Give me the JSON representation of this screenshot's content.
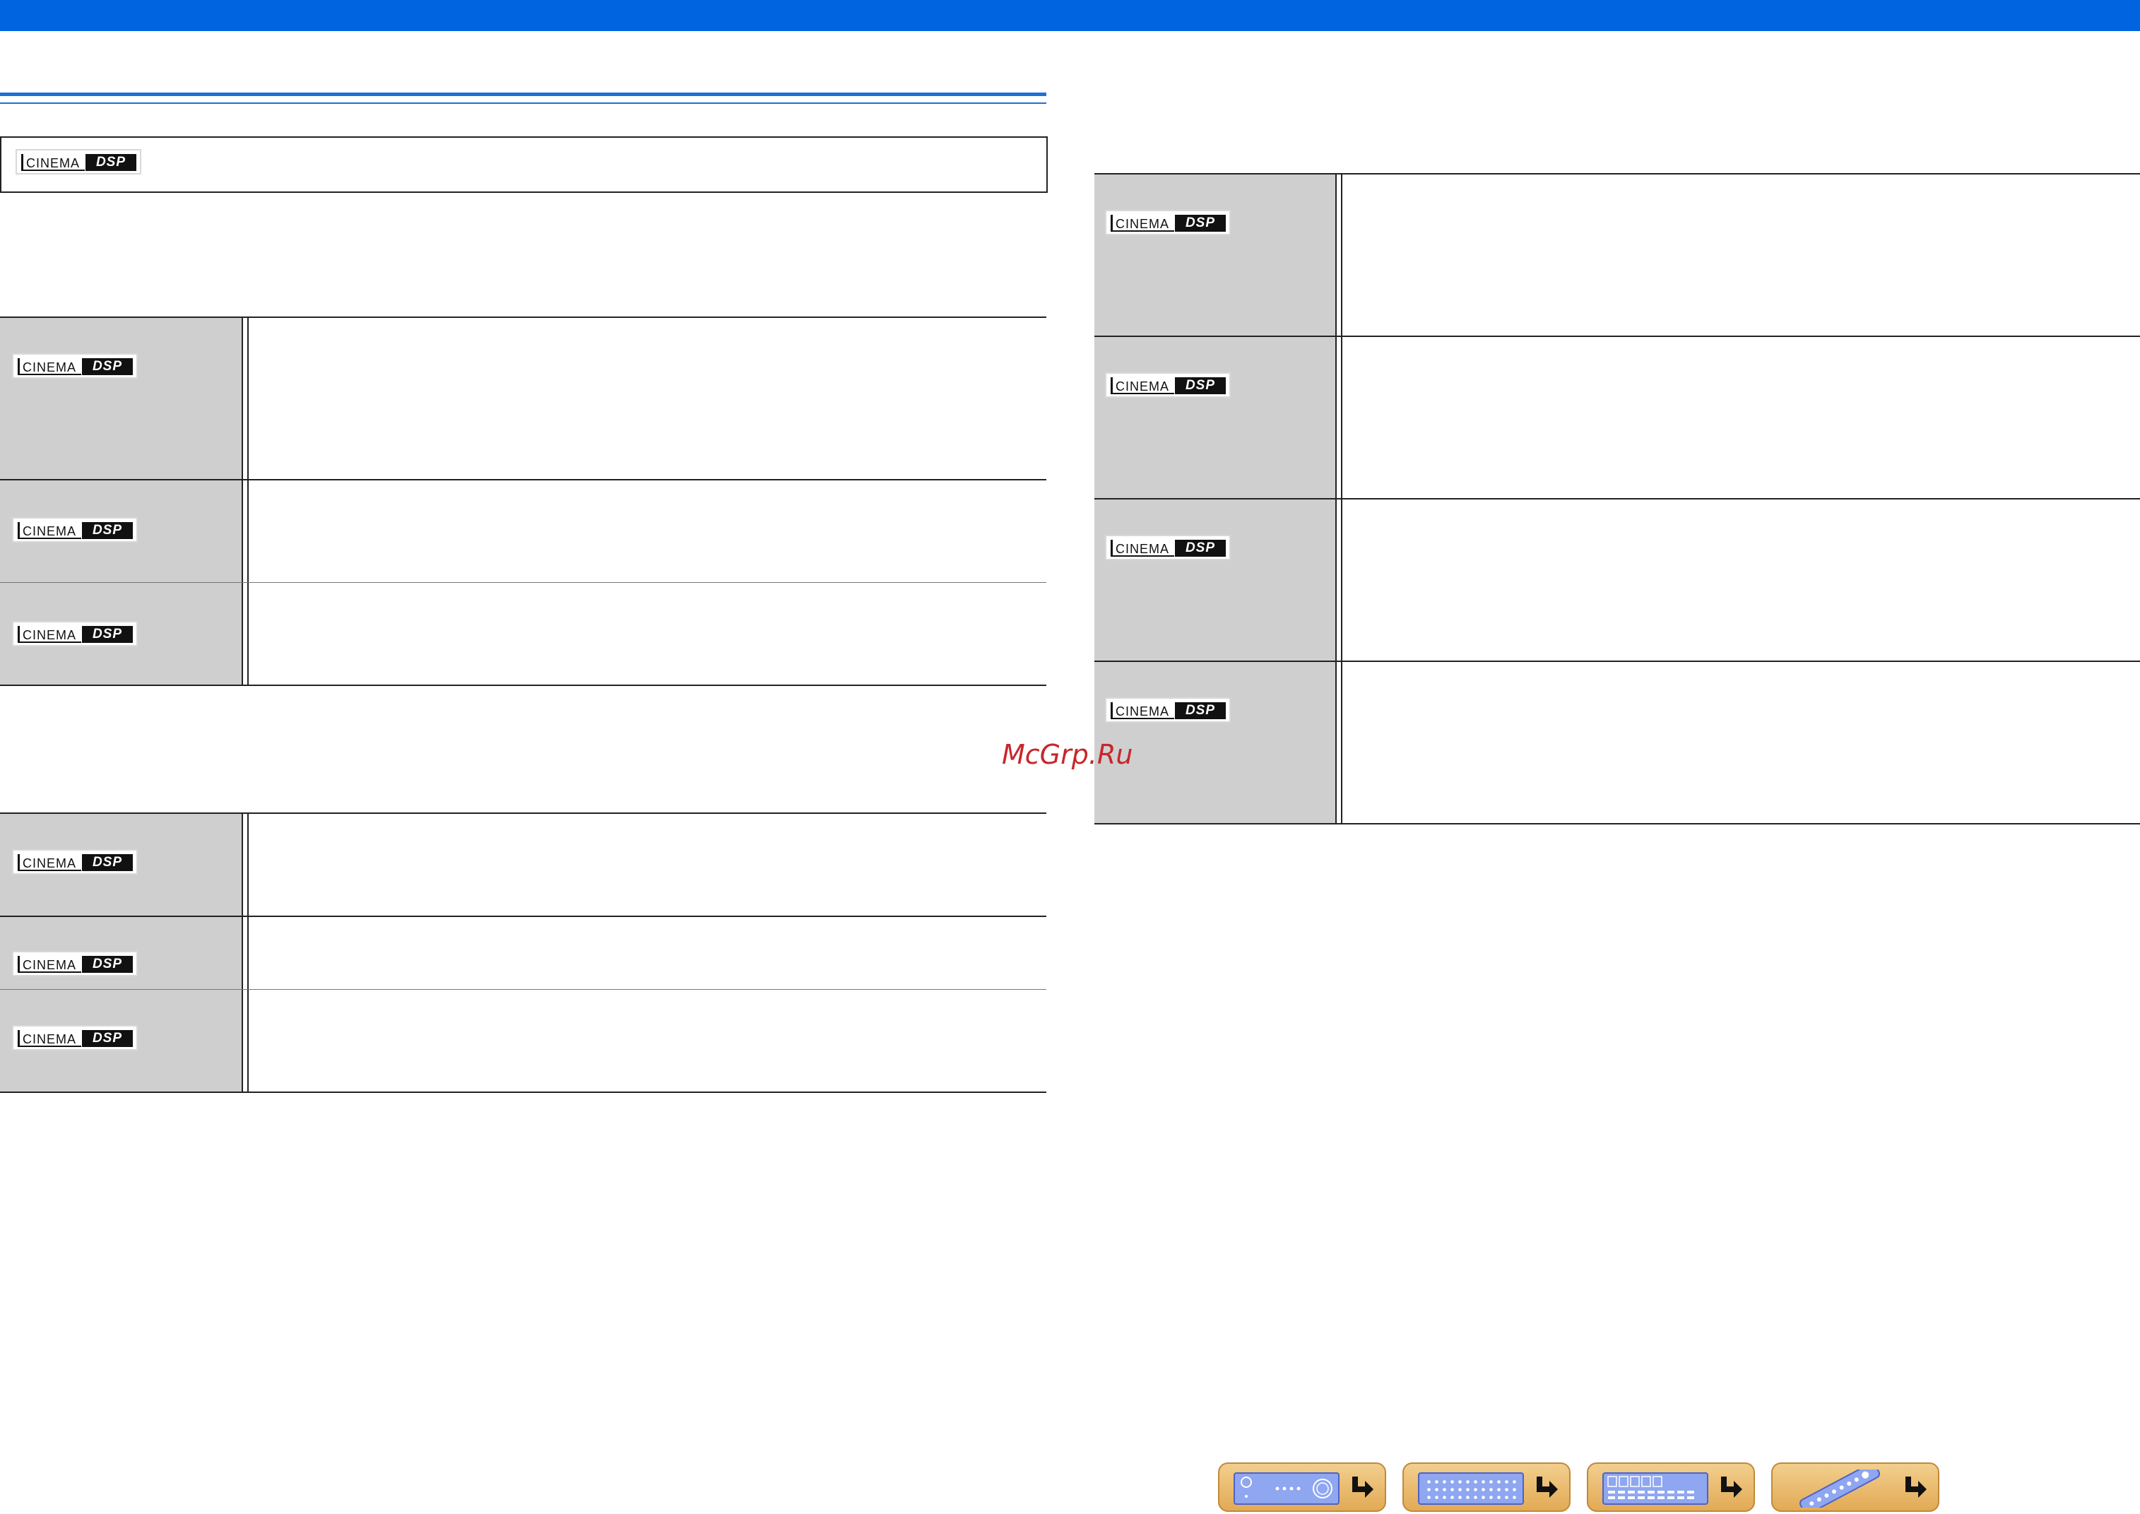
{
  "logo_text": {
    "cinema": "CINEMA",
    "dsp": "DSP"
  },
  "header_box": {
    "logo": "CINEMA DSP"
  },
  "left_table_1": {
    "rows": [
      {
        "logo": "CINEMA DSP"
      },
      {
        "logo": "CINEMA DSP"
      },
      {
        "logo": "CINEMA DSP"
      }
    ]
  },
  "left_table_2": {
    "rows": [
      {
        "logo": "CINEMA DSP"
      },
      {
        "logo": "CINEMA DSP"
      },
      {
        "logo": "CINEMA DSP"
      }
    ]
  },
  "right_table": {
    "rows": [
      {
        "logo": "CINEMA DSP"
      },
      {
        "logo": "CINEMA DSP"
      },
      {
        "logo": "CINEMA DSP"
      },
      {
        "logo": "CINEMA DSP"
      }
    ]
  },
  "watermark": "McGrp.Ru",
  "nav_buttons": [
    {
      "name": "front-panel",
      "icon": "front-panel-icon"
    },
    {
      "name": "rear-panel",
      "icon": "rear-panel-icon"
    },
    {
      "name": "display",
      "icon": "display-icon"
    },
    {
      "name": "remote-control",
      "icon": "remote-control-icon"
    }
  ],
  "colors": {
    "top_bar": "#0064e0",
    "rule": "#1e6fd9",
    "logo_cell": "#cfcfcf",
    "nav_button": "#e8b866",
    "watermark": "#c8262c"
  }
}
